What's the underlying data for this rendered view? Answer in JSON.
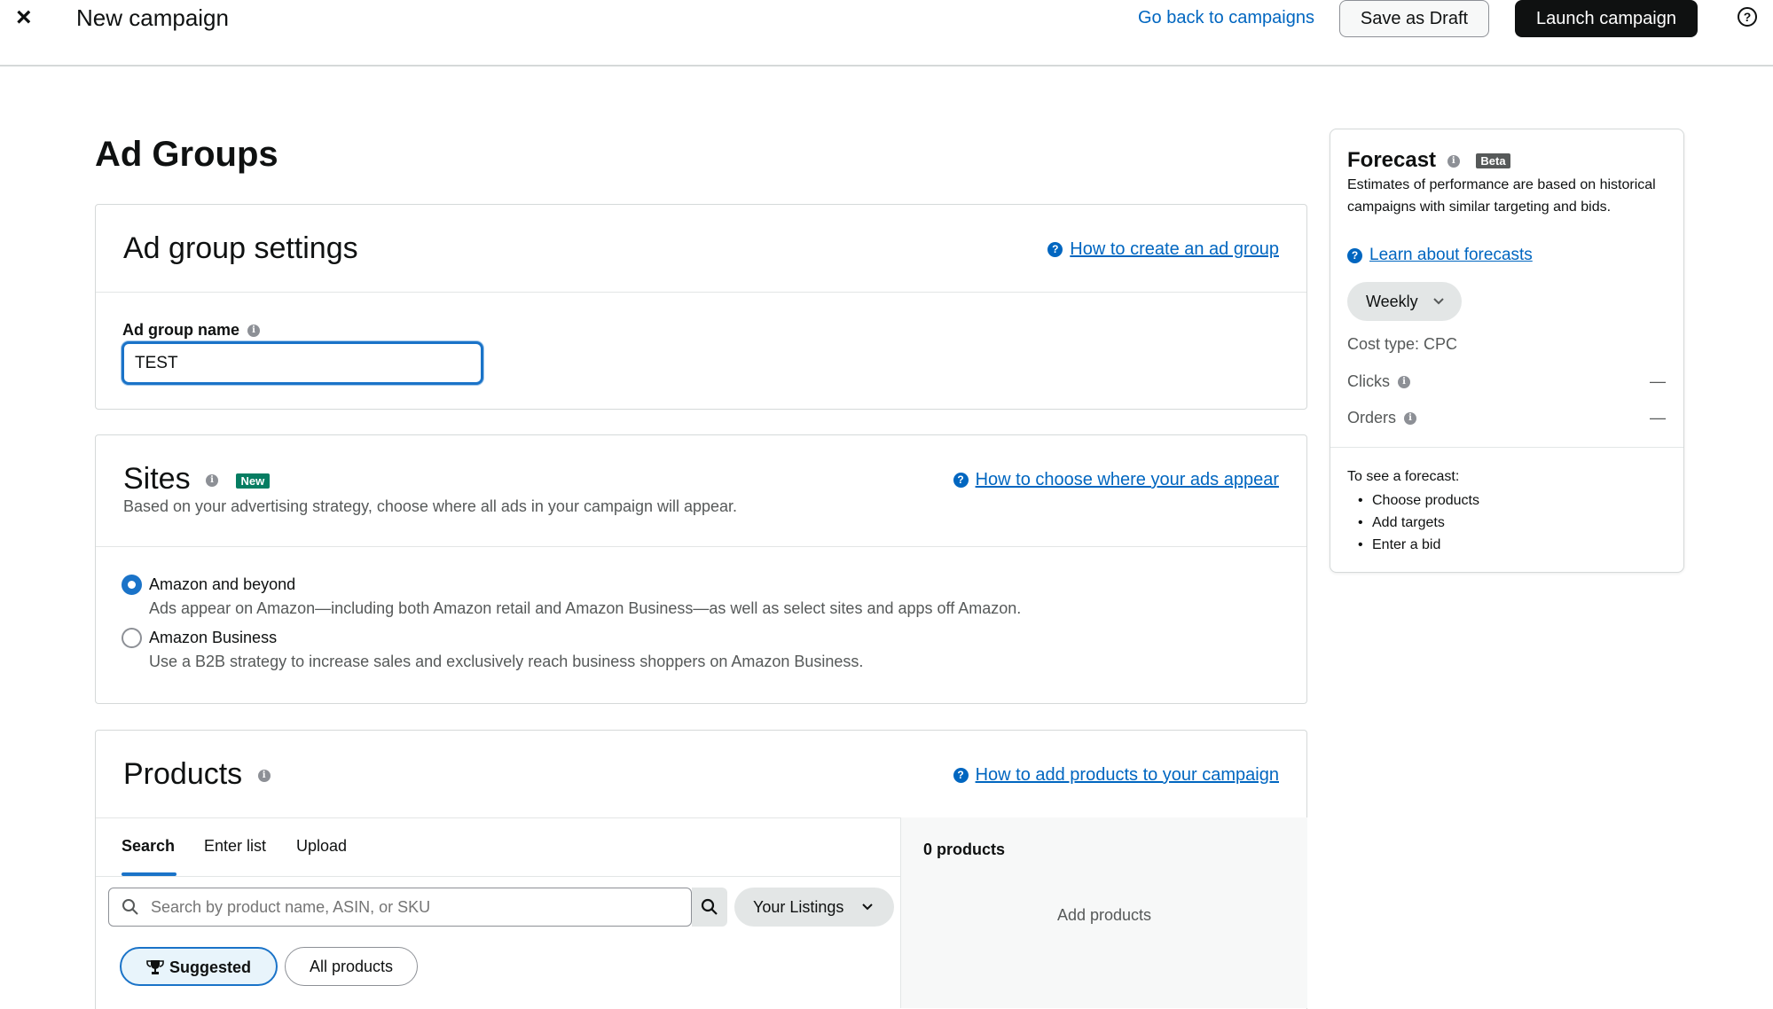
{
  "header": {
    "close_icon": "×",
    "title": "New campaign",
    "go_back_label": "Go back to campaigns",
    "save_draft_label": "Save as Draft",
    "launch_label": "Launch campaign",
    "help_icon": "?"
  },
  "page": {
    "heading": "Ad Groups"
  },
  "ad_group_settings": {
    "title": "Ad group settings",
    "help_link": "How to create an ad group",
    "name_label": "Ad group name",
    "name_value": "TEST"
  },
  "sites": {
    "title": "Sites",
    "badge": "New",
    "description": "Based on your advertising strategy, choose where all ads in your campaign will appear.",
    "help_link": "How to choose where your ads appear",
    "options": [
      {
        "label": "Amazon and beyond",
        "description": "Ads appear on Amazon—including both Amazon retail and Amazon Business—as well as select sites and apps off Amazon.",
        "selected": true
      },
      {
        "label": "Amazon Business",
        "description": "Use a B2B strategy to increase sales and exclusively reach business shoppers on Amazon Business.",
        "selected": false
      }
    ]
  },
  "products": {
    "title": "Products",
    "help_link": "How to add products to your campaign",
    "tabs": [
      {
        "label": "Search",
        "active": true
      },
      {
        "label": "Enter list",
        "active": false
      },
      {
        "label": "Upload",
        "active": false
      }
    ],
    "search_placeholder": "Search by product name, ASIN, or SKU",
    "listings_dropdown": "Your Listings",
    "filters": [
      {
        "label": "Suggested",
        "selected": true
      },
      {
        "label": "All products",
        "selected": false
      }
    ],
    "count_label": "0 products",
    "empty_label": "Add products"
  },
  "forecast": {
    "title": "Forecast",
    "badge": "Beta",
    "description": "Estimates of performance are based on historical campaigns with similar targeting and bids.",
    "learn_link": "Learn about forecasts",
    "period": "Weekly",
    "cost_type": "Cost type: CPC",
    "metrics": [
      {
        "label": "Clicks",
        "value": "—"
      },
      {
        "label": "Orders",
        "value": "—"
      }
    ],
    "hint": "To see a forecast:",
    "steps": [
      "Choose products",
      "Add targets",
      "Enter a bid"
    ]
  },
  "colors": {
    "link": "#0066c0",
    "accent": "#1a73c8",
    "dark_button": "#0f1111",
    "new_badge": "#067d62"
  }
}
